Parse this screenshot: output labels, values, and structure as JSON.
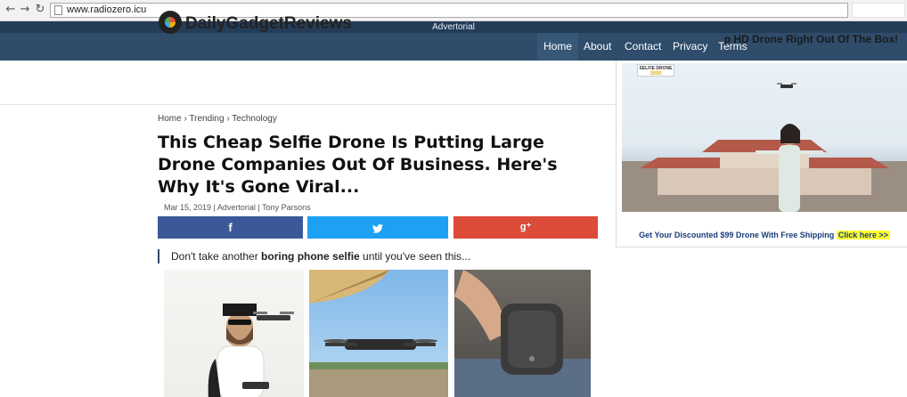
{
  "browser": {
    "url": "www.radiozero.icu",
    "icons": [
      "back-arrow-icon",
      "forward-arrow-icon",
      "reload-icon",
      "page-icon"
    ]
  },
  "header": {
    "advert_label": "Advertorial",
    "nav": [
      "Home",
      "About",
      "Contact",
      "Privacy",
      "Terms"
    ]
  },
  "site": {
    "logo_text": "DailyGadgetReviews",
    "logo_icon": "gear-camera-logo-icon"
  },
  "article": {
    "breadcrumb": [
      "Home",
      "Trending",
      "Technology"
    ],
    "breadcrumb_sep": "›",
    "headline": "This Cheap Selfie Drone Is Putting Large Drone Companies Out Of Business. Here's Why It's Gone Viral...",
    "meta": "Mar 15, 2019 | Advertorial | Tony Parsons",
    "share": {
      "facebook": "f",
      "twitter_icon": "twitter-bird-icon",
      "google": "g⁺"
    },
    "quote": {
      "pre": "Don't take another ",
      "bold": "boring phone selfie",
      "post": " until you've seen this..."
    }
  },
  "ad": {
    "headline": "p HD Drone Right Out Of The Box!",
    "headline_prefix_overlapped": "Contact Privacy Terms",
    "badge_line1": "SELFIE DRONE",
    "badge_line2": "3000",
    "cta": "Get Your Discounted $99 Drone With Free Shipping",
    "cta_link": "Click here >>"
  },
  "colors": {
    "navbar": "#2f4c6b",
    "advert_bar": "#233c58",
    "facebook": "#3b5998",
    "twitter": "#1da1f2",
    "google": "#dd4b39",
    "cta_highlight": "#ffff2e"
  }
}
